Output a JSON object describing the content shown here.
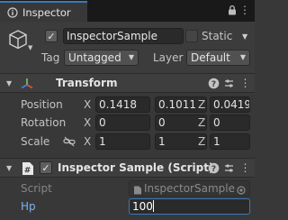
{
  "window": {
    "tab_title": "Inspector",
    "tab_icon": "info-icon",
    "menu_icon": "kebab-menu-icon",
    "lock_icon": "lock-icon"
  },
  "header": {
    "active_checked": true,
    "name": "InspectorSample",
    "static_label": "Static",
    "static_checked": false,
    "tag_label": "Tag",
    "tag_value": "Untagged",
    "layer_label": "Layer",
    "layer_value": "Default"
  },
  "transform": {
    "title": "Transform",
    "rows": [
      {
        "label": "Position",
        "x": "0.1418",
        "y": "0.1011",
        "z": "0.0419"
      },
      {
        "label": "Rotation",
        "x": "0",
        "y": "0",
        "z": "0"
      },
      {
        "label": "Scale",
        "x": "1",
        "y": "1",
        "z": "1"
      }
    ],
    "axis_x": "X",
    "axis_y": "Y",
    "axis_z": "Z"
  },
  "script_component": {
    "title": "Inspector Sample (Script)",
    "enabled": true,
    "script_label": "Script",
    "script_value": "InspectorSample",
    "hp_label": "Hp",
    "hp_value": "100"
  },
  "colors": {
    "accent": "#3a79bb",
    "background": "#383838",
    "field_bg": "#2a2a2a"
  }
}
